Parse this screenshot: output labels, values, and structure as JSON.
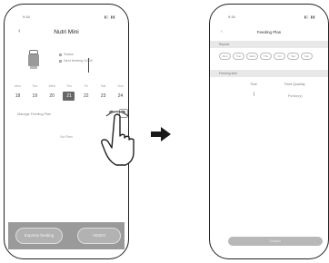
{
  "left_screen": {
    "status_time": "9:16",
    "status_icons": "▮▯ ▮▮",
    "back_icon": "left-arrow-icon",
    "title": "Nutri Mini",
    "info_line_1": "Status",
    "info_line_2": "Next feeding 10:00",
    "calendar": {
      "weekdays": [
        "Mon",
        "Tue",
        "Wed",
        "Thu",
        "Fri",
        "Sat",
        "Sun"
      ],
      "days": [
        "18",
        "19",
        "20",
        "21",
        "22",
        "23",
        "24"
      ],
      "selected_index": 3
    },
    "feed_plan_label": "Manage Feeding Plan",
    "empty_text": "No Plan",
    "buttons": {
      "express": "Express feeding",
      "video": "VIDEO"
    }
  },
  "arrow_icon": "right-arrow-icon",
  "right_screen": {
    "status_time": "9:16",
    "status_icons": "▮▯ ▮▮",
    "back_icon": "left-arrow-icon",
    "title": "Feeding Plan",
    "repeat_label": "Repeat",
    "week_chips": [
      "Mon",
      "Tue",
      "Wed",
      "Thu",
      "Fri",
      "Sat",
      "Sun"
    ],
    "feeding_time_label": "Feeding time",
    "col_time": "Time",
    "col_portion": "Feed Quantity",
    "time_value": "|",
    "portion_value": "Portion(s)",
    "confirm": "Confirm"
  }
}
